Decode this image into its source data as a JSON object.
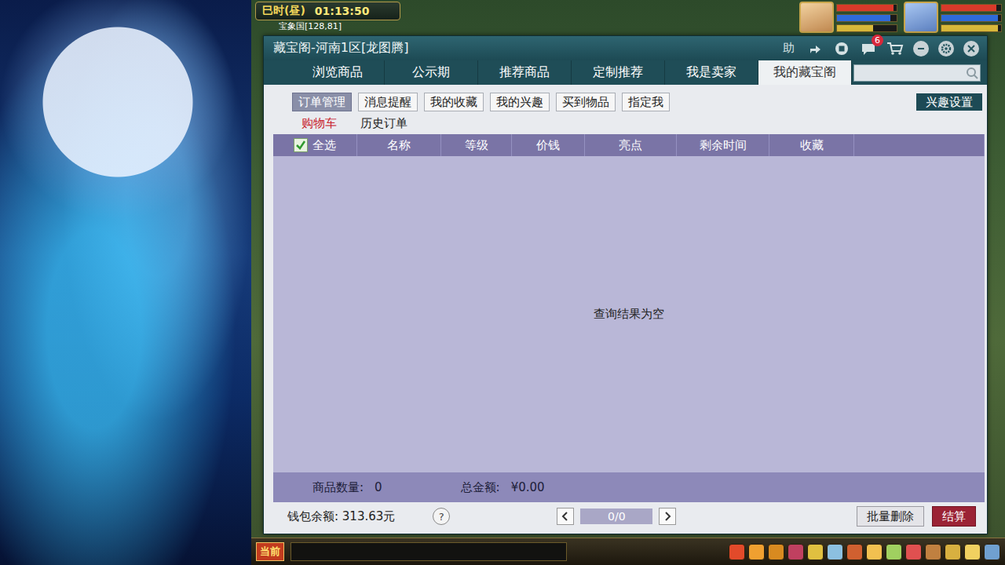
{
  "hud": {
    "period": "巳时(昼)",
    "clock": "01:13:50",
    "location": "宝象国[128,81]"
  },
  "party": [
    {
      "hp": 0.95,
      "mp": 0.9,
      "sp": 0.6
    },
    {
      "hp": 0.92,
      "mp": 0.95,
      "sp": 0.95
    }
  ],
  "window": {
    "title": "藏宝阁-河南1区[龙图腾]",
    "help": "助",
    "chat_badge": "6"
  },
  "tabs": [
    {
      "label": "浏览商品",
      "selected": false
    },
    {
      "label": "公示期",
      "selected": false
    },
    {
      "label": "推荐商品",
      "selected": false
    },
    {
      "label": "定制推荐",
      "selected": false
    },
    {
      "label": "我是卖家",
      "selected": false
    },
    {
      "label": "我的藏宝阁",
      "selected": true
    }
  ],
  "search": {
    "placeholder": ""
  },
  "subtabs": [
    {
      "label": "订单管理",
      "selected": true
    },
    {
      "label": "消息提醒",
      "selected": false
    },
    {
      "label": "我的收藏",
      "selected": false
    },
    {
      "label": "我的兴趣",
      "selected": false
    },
    {
      "label": "买到物品",
      "selected": false
    },
    {
      "label": "指定我",
      "selected": false
    }
  ],
  "interest_button": "兴趣设置",
  "order_tabs": [
    {
      "label": "购物车",
      "selected": true
    },
    {
      "label": "历史订单",
      "selected": false
    }
  ],
  "table": {
    "select_all": {
      "label": "全选",
      "checked": true
    },
    "columns": [
      "名称",
      "等级",
      "价钱",
      "亮点",
      "剩余时间",
      "收藏"
    ],
    "rows": [],
    "empty_message": "查询结果为空"
  },
  "summary": {
    "count_label": "商品数量:",
    "count": "0",
    "total_label": "总金额:",
    "total": "¥0.00"
  },
  "wallet": "钱包余额: 313.63元",
  "help": "?",
  "pagination": {
    "page": "0/0"
  },
  "buttons": [
    "批量删除",
    "结算"
  ],
  "bottom_bar": {
    "channel": "当前"
  }
}
